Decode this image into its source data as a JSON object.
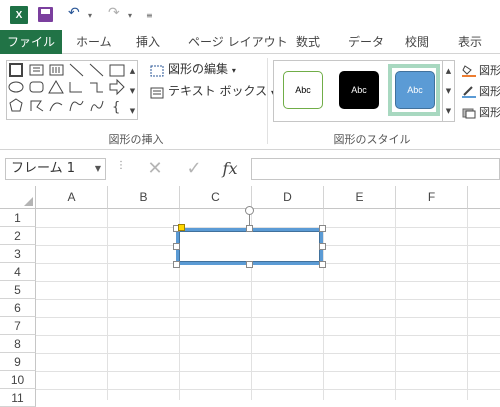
{
  "quick_access": {
    "app_icon": "X",
    "undo_glyph": "↶",
    "redo_glyph": "↷",
    "dropdown_glyph": "▾",
    "customize_glyph": "≡"
  },
  "ribbon_tabs": [
    {
      "label": "ファイル"
    },
    {
      "label": "ホーム"
    },
    {
      "label": "挿入"
    },
    {
      "label": "ページ レイアウト"
    },
    {
      "label": "数式"
    },
    {
      "label": "データ"
    },
    {
      "label": "校閲"
    },
    {
      "label": "表示"
    }
  ],
  "ribbon": {
    "insert_shapes_group": {
      "label": "図形の挿入",
      "edit_shape_label": "図形の編集",
      "text_box_label": "テキスト ボックス"
    },
    "shape_styles_group": {
      "label": "図形のスタイル",
      "swatches": [
        "Abc",
        "Abc",
        "Abc"
      ],
      "fill_label": "図形",
      "outline_label": "図形",
      "effects_label": "図形"
    }
  },
  "formula_bar": {
    "name_box_value": "フレーム 1",
    "cancel_glyph": "✕",
    "enter_glyph": "✓",
    "fx_label": "fx",
    "formula_value": ""
  },
  "sheet": {
    "columns": [
      "A",
      "B",
      "C",
      "D",
      "E",
      "F"
    ],
    "rows": [
      "1",
      "2",
      "3",
      "4",
      "5",
      "6",
      "7",
      "8",
      "9",
      "10",
      "11"
    ]
  },
  "colors": {
    "excel_green": "#217346",
    "shape_fill": "#5b9bd5",
    "shape_selected_border": "#a8d8c0"
  }
}
